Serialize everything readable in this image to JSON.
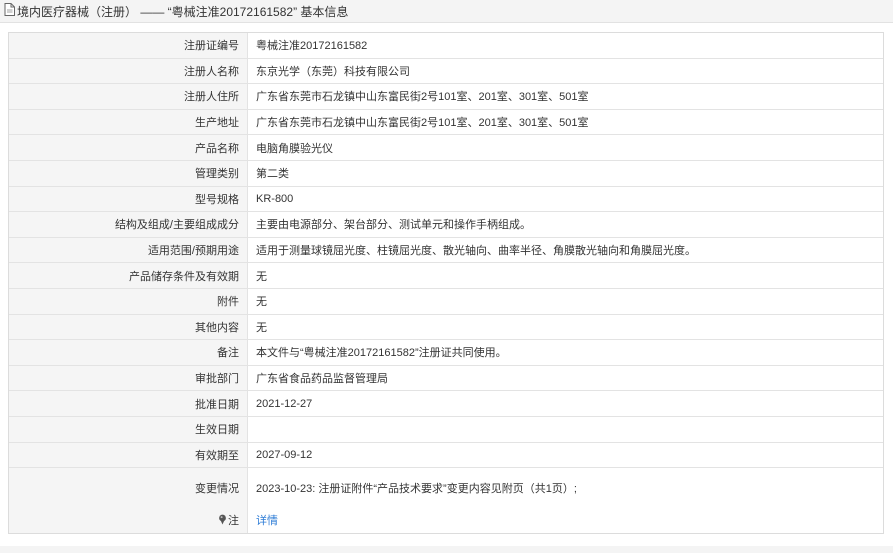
{
  "header": {
    "icon": "document-icon",
    "title": "境内医疗器械（注册） —— “粤械注准20172161582” 基本信息"
  },
  "rows": [
    {
      "label": "注册证编号",
      "value": "粤械注准20172161582"
    },
    {
      "label": "注册人名称",
      "value": "东京光学（东莞）科技有限公司"
    },
    {
      "label": "注册人住所",
      "value": "广东省东莞市石龙镇中山东富民街2号101室、201室、301室、501室"
    },
    {
      "label": "生产地址",
      "value": "广东省东莞市石龙镇中山东富民街2号101室、201室、301室、501室"
    },
    {
      "label": "产品名称",
      "value": "电脑角膜验光仪"
    },
    {
      "label": "管理类别",
      "value": "第二类"
    },
    {
      "label": "型号规格",
      "value": "KR-800"
    },
    {
      "label": "结构及组成/主要组成成分",
      "value": "主要由电源部分、架台部分、测试单元和操作手柄组成。"
    },
    {
      "label": "适用范围/预期用途",
      "value": "适用于测量球镜屈光度、柱镜屈光度、散光轴向、曲率半径、角膜散光轴向和角膜屈光度。"
    },
    {
      "label": "产品储存条件及有效期",
      "value": "无"
    },
    {
      "label": "附件",
      "value": "无"
    },
    {
      "label": "其他内容",
      "value": "无"
    },
    {
      "label": "备注",
      "value": "本文件与“粤械注准20172161582”注册证共同使用。"
    },
    {
      "label": "审批部门",
      "value": "广东省食品药品监督管理局"
    },
    {
      "label": "批准日期",
      "value": "2021-12-27"
    },
    {
      "label": "生效日期",
      "value": ""
    },
    {
      "label": "有效期至",
      "value": "2027-09-12"
    },
    {
      "label": "变更情况",
      "value": "2023-10-23: 注册证附件“产品技术要求”变更内容见附页（共1页）;"
    }
  ],
  "note_row": {
    "icon": "pin-icon",
    "label": "注",
    "link_text": "详情"
  },
  "colors": {
    "link": "#2b7bd6",
    "label_bg": "#f5f5f5",
    "border": "#e3e3e3"
  }
}
